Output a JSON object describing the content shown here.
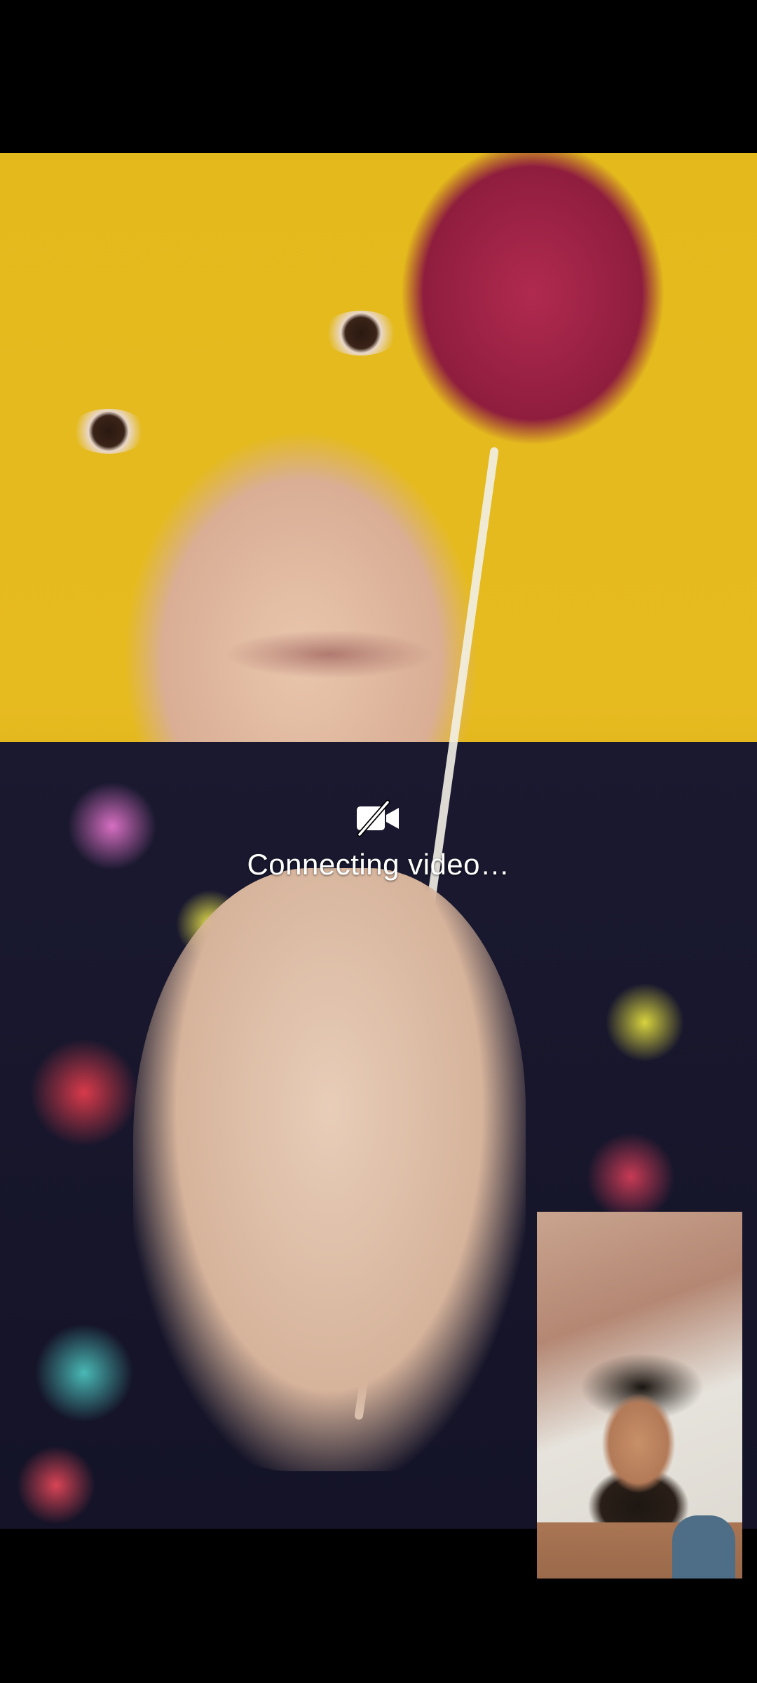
{
  "call": {
    "status_text": "Connecting video…",
    "status_icon": "video-off-icon"
  },
  "remote_video": {
    "description_icon": "remote-video-feed"
  },
  "self_preview": {
    "icon": "self-camera-preview"
  },
  "colors": {
    "background": "#000000",
    "status_text": "#ffffff"
  }
}
